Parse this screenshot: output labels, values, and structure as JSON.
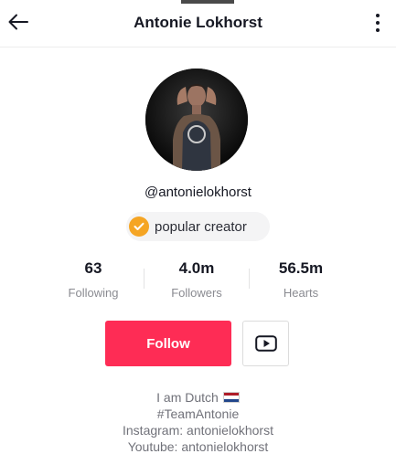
{
  "header": {
    "title": "Antonie Lokhorst",
    "back_icon": "arrow-left-icon",
    "more_icon": "vertical-dots-icon"
  },
  "profile": {
    "username": "@antonielokhorst",
    "badge_label": "popular creator",
    "badge_icon": "check-circle-icon",
    "badge_color": "#f5a524"
  },
  "stats": [
    {
      "value": "63",
      "label": "Following"
    },
    {
      "value": "4.0m",
      "label": "Followers"
    },
    {
      "value": "56.5m",
      "label": "Hearts"
    }
  ],
  "actions": {
    "follow_label": "Follow",
    "follow_color": "#fe2c55",
    "youtube_icon": "youtube-play-icon"
  },
  "bio": {
    "line1": "I am Dutch",
    "line1_emoji": "netherlands-flag",
    "line2": "#TeamAntonie",
    "line3": "Instagram: antonielokhorst",
    "line4": "Youtube: antonielokhorst"
  }
}
